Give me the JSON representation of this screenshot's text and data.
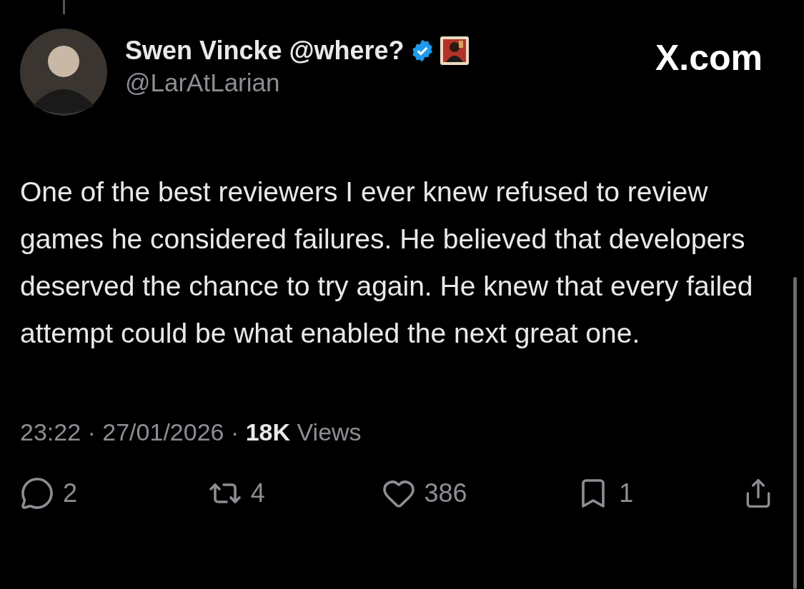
{
  "post": {
    "author": {
      "name": "Swen Vincke @where?",
      "verified": true,
      "handle": "@LarAtLarian"
    },
    "source": "X.com",
    "text": "One of the best reviewers I ever knew refused to review games he considered failures. He believed that developers deserved the chance to try again. He knew that every failed attempt could be what enabled the next great one.",
    "meta": "23:22 · 27/01/2026 · **18K** Views",
    "actions": [
      {
        "kind": "reply",
        "count": "2"
      },
      {
        "kind": "repost",
        "count": "4"
      },
      {
        "kind": "like",
        "count": "386"
      },
      {
        "kind": "bookmark",
        "count": "1"
      },
      {
        "kind": "share"
      }
    ]
  }
}
